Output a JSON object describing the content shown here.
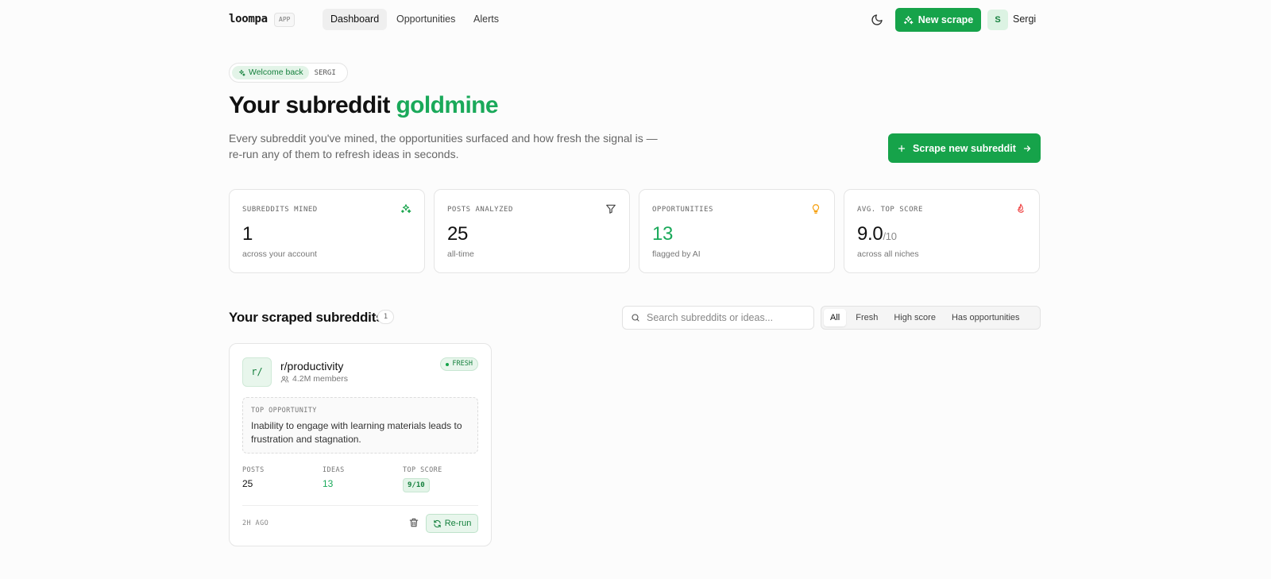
{
  "nav": {
    "logo": "loompa",
    "app_badge": "APP",
    "tabs": [
      {
        "label": "Dashboard",
        "active": true
      },
      {
        "label": "Opportunities",
        "active": false
      },
      {
        "label": "Alerts",
        "active": false
      }
    ],
    "new_scrape_label": "New scrape",
    "avatar_initial": "S",
    "username": "Sergi"
  },
  "hero": {
    "welcome_label": "Welcome back",
    "welcome_name": "SERGI",
    "title_prefix": "Your subreddit ",
    "title_accent": "goldmine",
    "description": "Every subreddit you've mined, the opportunities surfaced and how fresh the signal is — re-run any of them to refresh ideas in seconds.",
    "scrape_button": "Scrape new subreddit"
  },
  "stats": [
    {
      "label": "SUBREDDITS MINED",
      "value": "1",
      "unit": "",
      "sub": "across your account",
      "icon": "sparkles-icon"
    },
    {
      "label": "POSTS ANALYZED",
      "value": "25",
      "unit": "",
      "sub": "all-time",
      "icon": "filter-icon"
    },
    {
      "label": "OPPORTUNITIES",
      "value": "13",
      "unit": "",
      "sub": "flagged by AI",
      "icon": "lightbulb-icon"
    },
    {
      "label": "AVG. TOP SCORE",
      "value": "9.0",
      "unit": "/10",
      "sub": "across all niches",
      "icon": "flame-icon"
    }
  ],
  "section": {
    "title": "Your scraped subreddits",
    "count": "1",
    "search_placeholder": "Search subreddits or ideas...",
    "filters": [
      "All",
      "Fresh",
      "High score",
      "Has opportunities"
    ],
    "active_filter": "All"
  },
  "cards": [
    {
      "icon_text": "r/",
      "name": "r/productivity",
      "members": "4.2M members",
      "badge": "FRESH",
      "top_opportunity_label": "TOP OPPORTUNITY",
      "top_opportunity": "Inability to engage with learning materials leads to frustration and stagnation.",
      "posts_label": "POSTS",
      "posts": "25",
      "ideas_label": "IDEAS",
      "ideas": "13",
      "score_label": "TOP SCORE",
      "score": "9/10",
      "ago": "2H AGO",
      "rerun_label": "Re-run"
    }
  ],
  "colors": {
    "accent": "#16a34a",
    "accent_text": "#1aa95a",
    "accent_soft": "#e3f4e8"
  }
}
